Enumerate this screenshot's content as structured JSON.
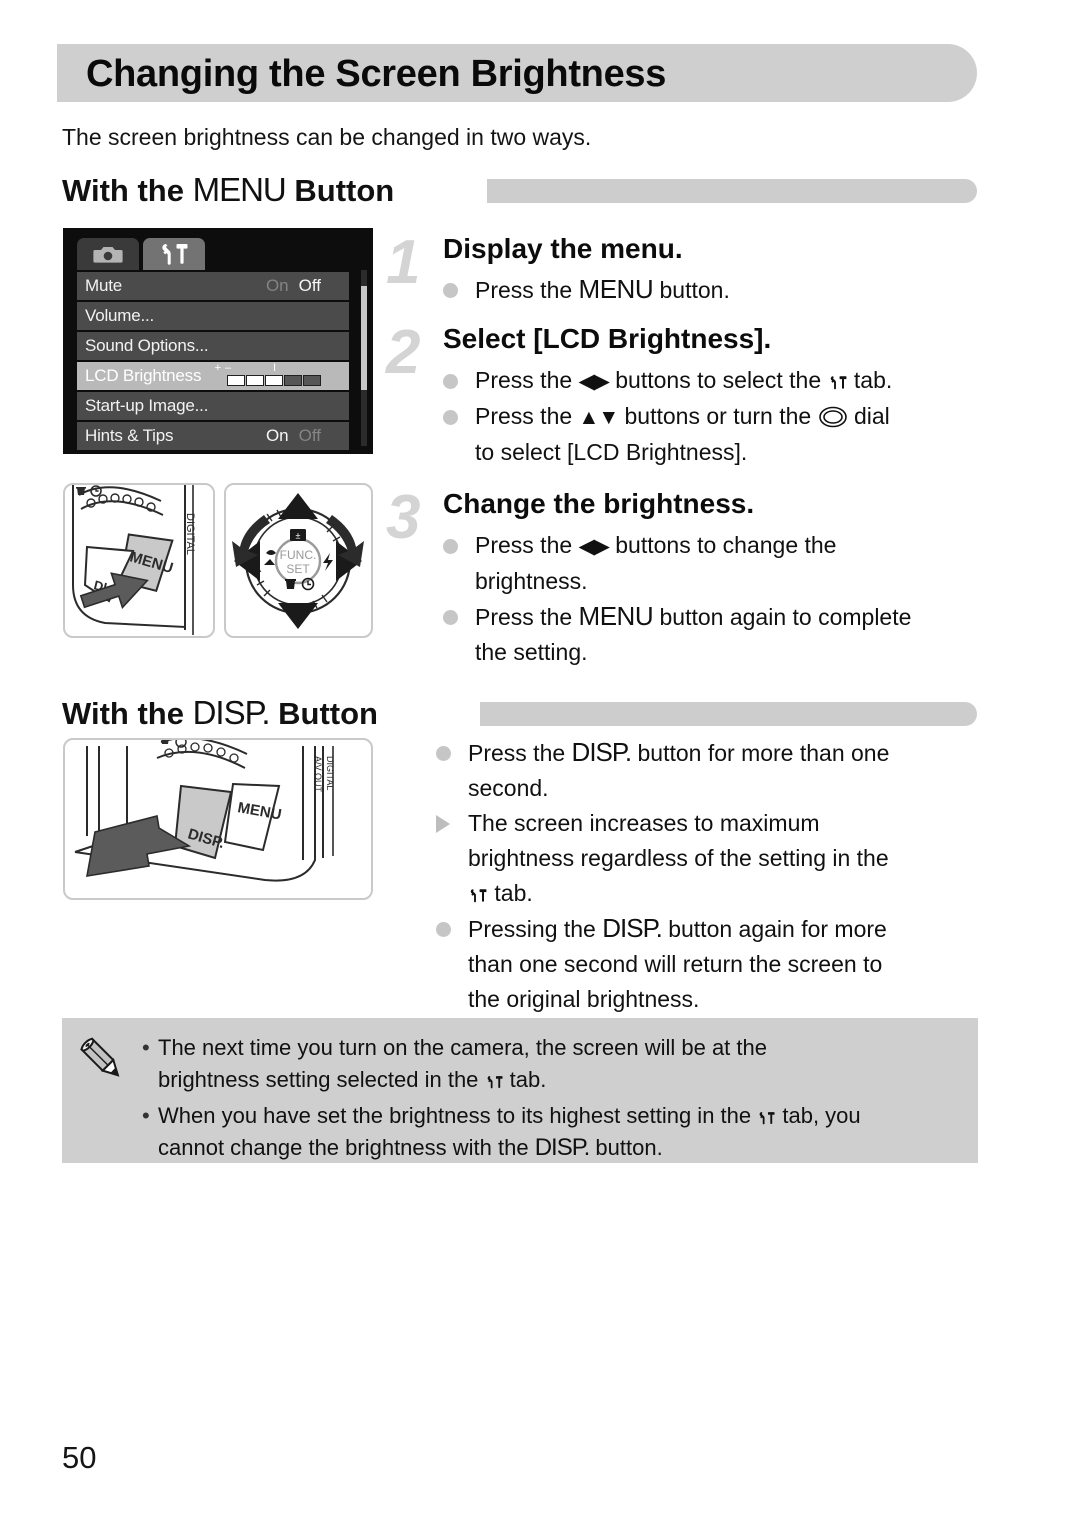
{
  "page": {
    "title": "Changing the Screen Brightness",
    "intro": "The screen brightness can be changed in two ways.",
    "page_number": "50"
  },
  "glyphs": {
    "menu": "MENU",
    "disp": "DISP.",
    "tool_tab": "tools-tab-icon",
    "left_right": "◀▶",
    "up_down": "▲▼",
    "dial": "control-dial-icon"
  },
  "sections": [
    {
      "id": "menu",
      "prefix": "With the ",
      "glyph": "MENU",
      "suffix": " Button"
    },
    {
      "id": "disp",
      "prefix": "With the ",
      "glyph": "DISP.",
      "suffix": " Button"
    }
  ],
  "lcd_screen": {
    "tabs": [
      {
        "name": "camera-tab",
        "icon": "camera-icon",
        "active": false
      },
      {
        "name": "tools-tab",
        "icon": "wrench-hammer-icon",
        "active": true
      }
    ],
    "rows": [
      {
        "label": "Mute",
        "values": [
          {
            "text": "On",
            "state": "dim"
          },
          {
            "text": "Off",
            "state": "on"
          }
        ],
        "selected": false
      },
      {
        "label": "Volume...",
        "values": [],
        "selected": false
      },
      {
        "label": "Sound Options...",
        "values": [],
        "selected": false
      },
      {
        "label": "LCD Brightness",
        "values": [],
        "selected": true,
        "slider": {
          "minus": "–",
          "mid": "I",
          "plus": "+",
          "cells": [
            1,
            1,
            1,
            0,
            0
          ]
        }
      },
      {
        "label": "Start-up Image...",
        "values": [],
        "selected": false
      },
      {
        "label": "Hints & Tips",
        "values": [
          {
            "text": "On",
            "state": "on"
          },
          {
            "text": "Off",
            "state": "dim"
          }
        ],
        "selected": false
      }
    ]
  },
  "steps": [
    {
      "number": "1",
      "title": "Display the menu.",
      "bullets": [
        {
          "marker": "dot",
          "parts": [
            {
              "t": "Press the "
            },
            {
              "g": "menu",
              "t": "MENU"
            },
            {
              "t": " button."
            }
          ]
        }
      ]
    },
    {
      "number": "2",
      "title": "Select [LCD Brightness].",
      "bullets": [
        {
          "marker": "dot",
          "parts": [
            {
              "t": "Press the "
            },
            {
              "g": "arrows",
              "t": "◀▶"
            },
            {
              "t": " buttons to select the "
            },
            {
              "g": "tool"
            },
            {
              "t": " tab."
            }
          ]
        },
        {
          "marker": "dot",
          "parts": [
            {
              "t": "Press the "
            },
            {
              "g": "arrows",
              "t": "▲▼"
            },
            {
              "t": " buttons or turn the "
            },
            {
              "g": "dial"
            },
            {
              "t": " dial"
            }
          ]
        },
        {
          "marker": "none",
          "parts": [
            {
              "t": "to select [LCD Brightness]."
            }
          ]
        }
      ]
    },
    {
      "number": "3",
      "title": "Change the brightness.",
      "bullets": [
        {
          "marker": "dot",
          "parts": [
            {
              "t": "Press the "
            },
            {
              "g": "arrows",
              "t": "◀▶"
            },
            {
              "t": " buttons to change the"
            }
          ]
        },
        {
          "marker": "none",
          "parts": [
            {
              "t": "brightness."
            }
          ]
        },
        {
          "marker": "dot",
          "parts": [
            {
              "t": "Press the "
            },
            {
              "g": "menu",
              "t": "MENU"
            },
            {
              "t": " button again to complete"
            }
          ]
        },
        {
          "marker": "none",
          "parts": [
            {
              "t": "the setting."
            }
          ]
        }
      ]
    }
  ],
  "disp_section": {
    "bullets": [
      {
        "marker": "dot",
        "parts": [
          {
            "t": "Press the "
          },
          {
            "g": "disp",
            "t": "DISP."
          },
          {
            "t": " button for more than one"
          }
        ]
      },
      {
        "marker": "none",
        "parts": [
          {
            "t": "second."
          }
        ]
      },
      {
        "marker": "tri",
        "parts": [
          {
            "t": "The screen increases to maximum"
          }
        ]
      },
      {
        "marker": "none",
        "parts": [
          {
            "t": "brightness regardless of the setting in the"
          }
        ]
      },
      {
        "marker": "none",
        "parts": [
          {
            "g": "tool"
          },
          {
            "t": " tab."
          }
        ]
      },
      {
        "marker": "dot",
        "parts": [
          {
            "t": "Pressing the "
          },
          {
            "g": "disp",
            "t": "DISP."
          },
          {
            "t": " button again for more"
          }
        ]
      },
      {
        "marker": "none",
        "parts": [
          {
            "t": "than one second will return the screen to"
          }
        ]
      },
      {
        "marker": "none",
        "parts": [
          {
            "t": "the original brightness."
          }
        ]
      }
    ]
  },
  "note_box": {
    "icon": "pencil-icon",
    "items": [
      [
        {
          "t": "The next time you turn on the camera, the screen will be at the"
        }
      ],
      [
        {
          "t": "brightness setting selected in the "
        },
        {
          "g": "tool"
        },
        {
          "t": " tab."
        }
      ],
      [
        {
          "t": "When you have set the brightness to its highest setting in the "
        },
        {
          "g": "tool"
        },
        {
          "t": " tab, you"
        }
      ],
      [
        {
          "t": "cannot change the brightness with the "
        },
        {
          "g": "disp",
          "t": "DISP."
        },
        {
          "t": " button."
        }
      ]
    ],
    "bullet_rows": [
      0,
      2
    ]
  },
  "illustrations": {
    "menu_button": {
      "name": "camera-back-menu-button-illustration",
      "labels": [
        "MENU",
        "DISP."
      ]
    },
    "control_dial": {
      "name": "control-dial-illustration",
      "labels": [
        "FUNC.",
        "SET"
      ]
    },
    "disp_button": {
      "name": "camera-back-disp-button-illustration",
      "labels": [
        "MENU",
        "DISP.",
        "A/V OUT",
        "DIGITAL"
      ]
    }
  },
  "colors": {
    "bar_gray": "#cfcfcf",
    "step_number_gray": "#d4d4d4",
    "bullet_gray": "#c6c6c6",
    "lcd_bg": "#0d0d0d",
    "lcd_row": "#4b4b4b",
    "lcd_row_selected": "#b9b9b9"
  }
}
